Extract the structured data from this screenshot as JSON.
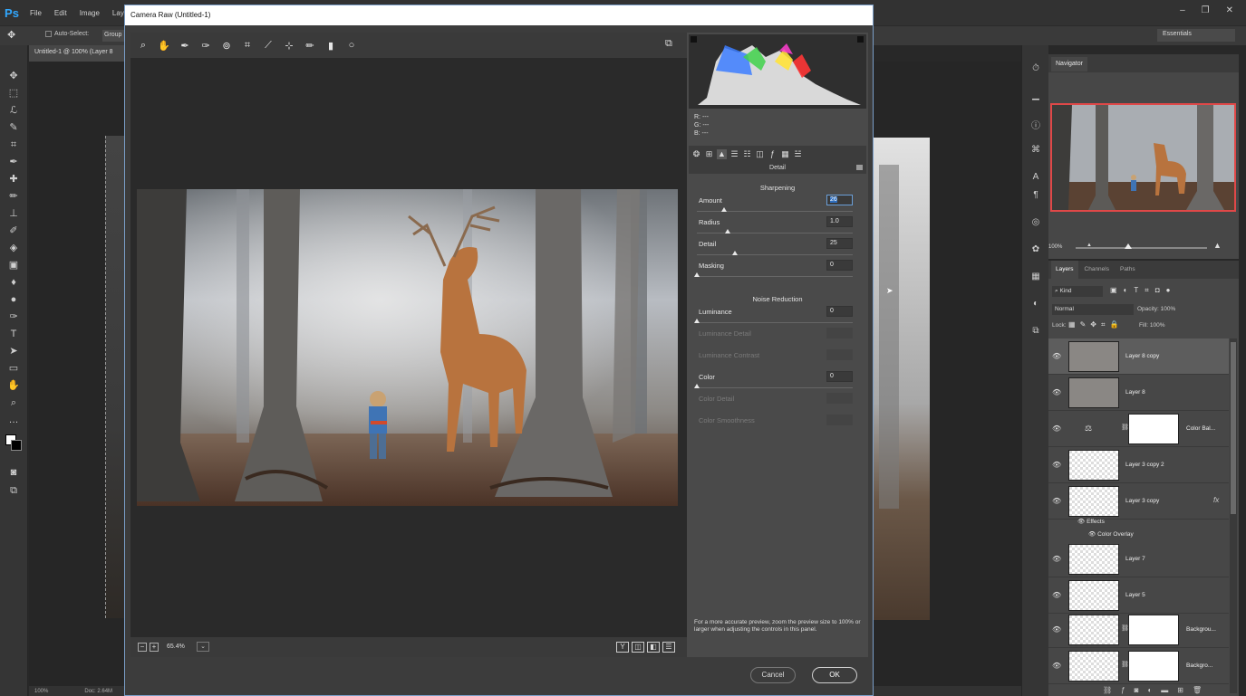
{
  "ps": {
    "logo": "Ps",
    "menus": [
      "File",
      "Edit",
      "Image",
      "Lay"
    ],
    "winctrl": [
      "–",
      "❐",
      "✕"
    ],
    "auto_select": "Auto-Select:",
    "group_select": "Group",
    "workspace": "Essentials",
    "doc_tab": "Untitled-1 @ 100% (Layer 8",
    "status_zoom": "100%",
    "status_doc": "Doc: 2.64M"
  },
  "dialog": {
    "title": "Camera Raw (Untitled-1)",
    "zoom_minus": "−",
    "zoom_plus": "+",
    "zoom_level": "65.4%",
    "zoom_drop": "⌄",
    "view_icons": [
      "Y",
      "◫",
      "◧",
      "☰"
    ],
    "cancel_label": "Cancel",
    "ok_label": "OK"
  },
  "panel": {
    "rgb": {
      "r": "R:    ---",
      "g": "G:    ---",
      "b": "B:    ---"
    },
    "title": "Detail",
    "sharpening_head": "Sharpening",
    "noise_head": "Noise Reduction",
    "sharpening": [
      {
        "label": "Amount",
        "value": "26",
        "pos": 0.18
      },
      {
        "label": "Radius",
        "value": "1.0",
        "pos": 0.2
      },
      {
        "label": "Detail",
        "value": "25",
        "pos": 0.25
      },
      {
        "label": "Masking",
        "value": "0",
        "pos": 0.0
      }
    ],
    "noise": [
      {
        "label": "Luminance",
        "value": "0",
        "pos": 0.0
      },
      {
        "label": "Luminance Detail",
        "value": "",
        "pos": null
      },
      {
        "label": "Luminance Contrast",
        "value": "",
        "pos": null
      },
      {
        "label": "Color",
        "value": "0",
        "pos": 0.0
      },
      {
        "label": "Color Detail",
        "value": "",
        "pos": null
      },
      {
        "label": "Color Smoothness",
        "value": "",
        "pos": null
      }
    ],
    "footer": "For a more accurate preview, zoom the preview size to 100% or larger when adjusting the controls in this panel."
  },
  "navigator": {
    "tab": "Navigator",
    "zoom": "100%"
  },
  "layers": {
    "tabs": [
      "Layers",
      "Channels",
      "Paths"
    ],
    "kind": "⌕ Kind",
    "blend": "Normal",
    "opacity": "Opacity: 100%",
    "lock": "Lock:",
    "fill": "Fill: 100%",
    "items": [
      {
        "name": "Layer 8 copy"
      },
      {
        "name": "Layer 8"
      },
      {
        "name": "Color Bal..."
      },
      {
        "name": "Layer 3 copy 2"
      },
      {
        "name": "Layer 3 copy"
      },
      {
        "name": "Layer 7"
      },
      {
        "name": "Layer 5"
      },
      {
        "name": "Backgrou..."
      },
      {
        "name": "Backgro..."
      }
    ],
    "effects": "Effects",
    "color_overlay": "Color Overlay",
    "fx": "fx"
  }
}
